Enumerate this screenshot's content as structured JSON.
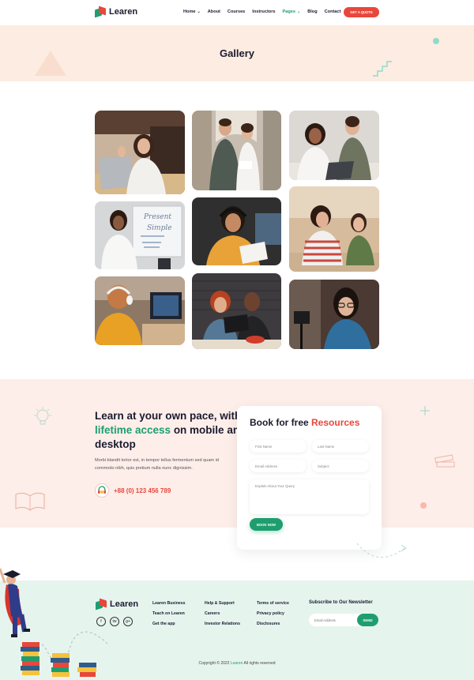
{
  "header": {
    "logo_text": "Learen",
    "nav": [
      {
        "label": "Home",
        "has_caret": true,
        "active": false
      },
      {
        "label": "About",
        "has_caret": false,
        "active": false
      },
      {
        "label": "Courses",
        "has_caret": false,
        "active": false
      },
      {
        "label": "Instructors",
        "has_caret": false,
        "active": false
      },
      {
        "label": "Pages",
        "has_caret": true,
        "active": true
      },
      {
        "label": "Blog",
        "has_caret": false,
        "active": false
      },
      {
        "label": "Contact",
        "has_caret": false,
        "active": false
      }
    ],
    "cta_label": "GET A QUOTE",
    "caret_glyph": "⌄"
  },
  "banner": {
    "title": "Gallery"
  },
  "gallery": {
    "photos": [
      {
        "name": "woman-waving-laptop",
        "bg": "#cdb8a4"
      },
      {
        "name": "two-students-hallway",
        "bg": "#b9b2a8"
      },
      {
        "name": "women-laptop-table",
        "bg": "#d9d4cf"
      },
      {
        "name": "teacher-whiteboard",
        "bg": "#dcdfe2"
      },
      {
        "name": "woman-headphones-paper",
        "bg": "#3a3a3a"
      },
      {
        "name": "mother-daughter-study",
        "bg": "#d2b89a"
      },
      {
        "name": "woman-headphones-monitor",
        "bg": "#8a7766"
      },
      {
        "name": "couple-tablet-brick",
        "bg": "#4c4a4d"
      },
      {
        "name": "woman-glasses-camera",
        "bg": "#4c3c36"
      }
    ]
  },
  "learn": {
    "heading_part1": "Learn at your own pace, with ",
    "heading_accent": "lifetime access",
    "heading_part2": " on mobile and desktop",
    "body": "Morbi blandit tortor est, in tempor tellus fermentum sed quam id commodo nibh, quis pretium nulla nunc dignissim.",
    "phone": "+88 (0) 123 456 789"
  },
  "form": {
    "title_part1": "Book for free ",
    "title_accent": "Resources",
    "first_name": "First Name",
    "last_name": "Last Name",
    "email": "Email Address",
    "subject": "Subject",
    "message": "Explain About Your Query",
    "button": "BOOK NOW"
  },
  "footer": {
    "logo_text": "Learen",
    "col1": [
      "Learen Business",
      "Teach on Learen",
      "Get the app"
    ],
    "col2": [
      "Help & Support",
      "Careers",
      "Investor Relations"
    ],
    "col3": [
      "Terms of service",
      "Privacy policy",
      "Disclosures"
    ],
    "social": [
      "f",
      "tw",
      "g+"
    ],
    "newsletter_title": "Subscribe to Our Newsletter",
    "newsletter_placeholder": "Email Address",
    "newsletter_button": "SEND",
    "copyright_prefix": "Copyright © 2022 ",
    "copyright_brand": "Learen",
    "copyright_suffix": " All rights reserved"
  },
  "colors": {
    "accent_green": "#1e9e6f",
    "accent_red": "#e8473b",
    "banner_bg": "#fdece1",
    "learn_bg": "#fdeeea",
    "footer_bg": "#e6f4ee"
  }
}
